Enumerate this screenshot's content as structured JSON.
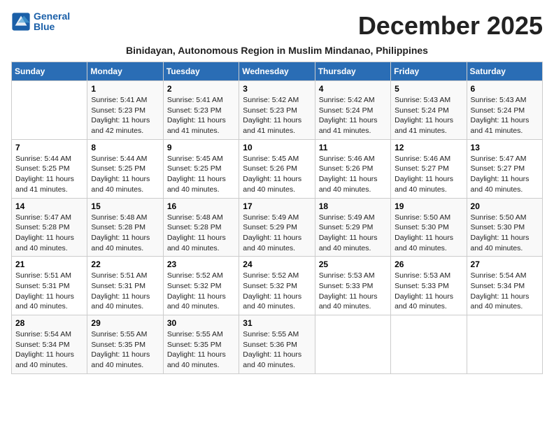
{
  "logo": {
    "line1": "General",
    "line2": "Blue"
  },
  "title": "December 2025",
  "subtitle": "Binidayan, Autonomous Region in Muslim Mindanao, Philippines",
  "days_of_week": [
    "Sunday",
    "Monday",
    "Tuesday",
    "Wednesday",
    "Thursday",
    "Friday",
    "Saturday"
  ],
  "weeks": [
    [
      {
        "day": "",
        "info": ""
      },
      {
        "day": "1",
        "info": "Sunrise: 5:41 AM\nSunset: 5:23 PM\nDaylight: 11 hours\nand 42 minutes."
      },
      {
        "day": "2",
        "info": "Sunrise: 5:41 AM\nSunset: 5:23 PM\nDaylight: 11 hours\nand 41 minutes."
      },
      {
        "day": "3",
        "info": "Sunrise: 5:42 AM\nSunset: 5:23 PM\nDaylight: 11 hours\nand 41 minutes."
      },
      {
        "day": "4",
        "info": "Sunrise: 5:42 AM\nSunset: 5:24 PM\nDaylight: 11 hours\nand 41 minutes."
      },
      {
        "day": "5",
        "info": "Sunrise: 5:43 AM\nSunset: 5:24 PM\nDaylight: 11 hours\nand 41 minutes."
      },
      {
        "day": "6",
        "info": "Sunrise: 5:43 AM\nSunset: 5:24 PM\nDaylight: 11 hours\nand 41 minutes."
      }
    ],
    [
      {
        "day": "7",
        "info": "Sunrise: 5:44 AM\nSunset: 5:25 PM\nDaylight: 11 hours\nand 41 minutes."
      },
      {
        "day": "8",
        "info": "Sunrise: 5:44 AM\nSunset: 5:25 PM\nDaylight: 11 hours\nand 40 minutes."
      },
      {
        "day": "9",
        "info": "Sunrise: 5:45 AM\nSunset: 5:25 PM\nDaylight: 11 hours\nand 40 minutes."
      },
      {
        "day": "10",
        "info": "Sunrise: 5:45 AM\nSunset: 5:26 PM\nDaylight: 11 hours\nand 40 minutes."
      },
      {
        "day": "11",
        "info": "Sunrise: 5:46 AM\nSunset: 5:26 PM\nDaylight: 11 hours\nand 40 minutes."
      },
      {
        "day": "12",
        "info": "Sunrise: 5:46 AM\nSunset: 5:27 PM\nDaylight: 11 hours\nand 40 minutes."
      },
      {
        "day": "13",
        "info": "Sunrise: 5:47 AM\nSunset: 5:27 PM\nDaylight: 11 hours\nand 40 minutes."
      }
    ],
    [
      {
        "day": "14",
        "info": "Sunrise: 5:47 AM\nSunset: 5:28 PM\nDaylight: 11 hours\nand 40 minutes."
      },
      {
        "day": "15",
        "info": "Sunrise: 5:48 AM\nSunset: 5:28 PM\nDaylight: 11 hours\nand 40 minutes."
      },
      {
        "day": "16",
        "info": "Sunrise: 5:48 AM\nSunset: 5:28 PM\nDaylight: 11 hours\nand 40 minutes."
      },
      {
        "day": "17",
        "info": "Sunrise: 5:49 AM\nSunset: 5:29 PM\nDaylight: 11 hours\nand 40 minutes."
      },
      {
        "day": "18",
        "info": "Sunrise: 5:49 AM\nSunset: 5:29 PM\nDaylight: 11 hours\nand 40 minutes."
      },
      {
        "day": "19",
        "info": "Sunrise: 5:50 AM\nSunset: 5:30 PM\nDaylight: 11 hours\nand 40 minutes."
      },
      {
        "day": "20",
        "info": "Sunrise: 5:50 AM\nSunset: 5:30 PM\nDaylight: 11 hours\nand 40 minutes."
      }
    ],
    [
      {
        "day": "21",
        "info": "Sunrise: 5:51 AM\nSunset: 5:31 PM\nDaylight: 11 hours\nand 40 minutes."
      },
      {
        "day": "22",
        "info": "Sunrise: 5:51 AM\nSunset: 5:31 PM\nDaylight: 11 hours\nand 40 minutes."
      },
      {
        "day": "23",
        "info": "Sunrise: 5:52 AM\nSunset: 5:32 PM\nDaylight: 11 hours\nand 40 minutes."
      },
      {
        "day": "24",
        "info": "Sunrise: 5:52 AM\nSunset: 5:32 PM\nDaylight: 11 hours\nand 40 minutes."
      },
      {
        "day": "25",
        "info": "Sunrise: 5:53 AM\nSunset: 5:33 PM\nDaylight: 11 hours\nand 40 minutes."
      },
      {
        "day": "26",
        "info": "Sunrise: 5:53 AM\nSunset: 5:33 PM\nDaylight: 11 hours\nand 40 minutes."
      },
      {
        "day": "27",
        "info": "Sunrise: 5:54 AM\nSunset: 5:34 PM\nDaylight: 11 hours\nand 40 minutes."
      }
    ],
    [
      {
        "day": "28",
        "info": "Sunrise: 5:54 AM\nSunset: 5:34 PM\nDaylight: 11 hours\nand 40 minutes."
      },
      {
        "day": "29",
        "info": "Sunrise: 5:55 AM\nSunset: 5:35 PM\nDaylight: 11 hours\nand 40 minutes."
      },
      {
        "day": "30",
        "info": "Sunrise: 5:55 AM\nSunset: 5:35 PM\nDaylight: 11 hours\nand 40 minutes."
      },
      {
        "day": "31",
        "info": "Sunrise: 5:55 AM\nSunset: 5:36 PM\nDaylight: 11 hours\nand 40 minutes."
      },
      {
        "day": "",
        "info": ""
      },
      {
        "day": "",
        "info": ""
      },
      {
        "day": "",
        "info": ""
      }
    ]
  ]
}
